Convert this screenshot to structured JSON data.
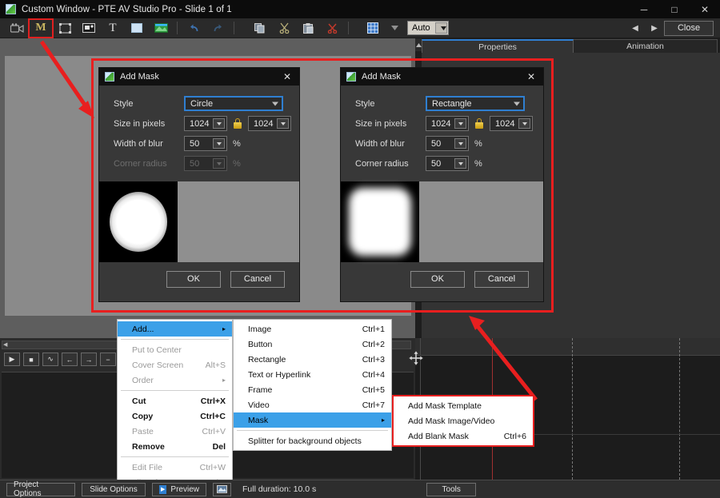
{
  "window": {
    "title": "Custom Window - PTE AV Studio Pro - Slide 1 of 1",
    "minimize": "─",
    "maximize": "□",
    "close": "✕"
  },
  "toolbar": {
    "items": [
      {
        "name": "camera-icon",
        "glyph": "🎥"
      },
      {
        "name": "mask-icon",
        "glyph": "M"
      },
      {
        "name": "frame-icon",
        "glyph": "⬜"
      },
      {
        "name": "image-icon",
        "glyph": "🖼"
      },
      {
        "name": "text-icon",
        "glyph": "T"
      },
      {
        "name": "rectangle-icon",
        "glyph": "■"
      },
      {
        "name": "video-icon",
        "glyph": "▰"
      },
      {
        "name": "undo-icon",
        "glyph": "↶"
      },
      {
        "name": "redo-icon",
        "glyph": "↷"
      },
      {
        "name": "copy-icon",
        "glyph": "⧉"
      },
      {
        "name": "cut-icon",
        "glyph": "✂"
      },
      {
        "name": "paste-icon",
        "glyph": "📋"
      },
      {
        "name": "delete-icon",
        "glyph": "✗"
      },
      {
        "name": "grid-icon",
        "glyph": "▦"
      }
    ],
    "zoom_value": "Auto",
    "prev_label": "◀",
    "next_label": "▶",
    "close_label": "Close"
  },
  "tabs": [
    {
      "label": "Properties",
      "active": true
    },
    {
      "label": "Animation",
      "active": false
    }
  ],
  "player_controls": [
    {
      "name": "play-button",
      "glyph": "▶"
    },
    {
      "name": "stop-button",
      "glyph": "■"
    },
    {
      "name": "waveform-button",
      "glyph": "∿"
    },
    {
      "name": "previous-button",
      "glyph": "←"
    },
    {
      "name": "next-button",
      "glyph": "→"
    },
    {
      "name": "zoom-out-button",
      "glyph": "−"
    },
    {
      "name": "zoom-in-button",
      "glyph": "+"
    }
  ],
  "dialog_left": {
    "title": "Add Mask",
    "close_glyph": "✕",
    "fields": {
      "style_label": "Style",
      "style_value": "Circle",
      "size_label": "Size in pixels",
      "size_width": "1024",
      "size_height": "1024",
      "blur_label": "Width of blur",
      "blur_value": "50",
      "blur_unit": "%",
      "corner_label": "Corner radius",
      "corner_value": "50",
      "corner_unit": "%"
    },
    "ok_label": "OK",
    "cancel_label": "Cancel"
  },
  "dialog_right": {
    "title": "Add Mask",
    "close_glyph": "✕",
    "fields": {
      "style_label": "Style",
      "style_value": "Rectangle",
      "size_label": "Size in pixels",
      "size_width": "1024",
      "size_height": "1024",
      "blur_label": "Width of blur",
      "blur_value": "50",
      "blur_unit": "%",
      "corner_label": "Corner radius",
      "corner_value": "50",
      "corner_unit": "%"
    },
    "ok_label": "OK",
    "cancel_label": "Cancel"
  },
  "context_menu": {
    "items": [
      {
        "label": "Add...",
        "accel": "",
        "submenu": true,
        "disabled": false,
        "selected": true,
        "bold": false
      },
      {
        "sep": true
      },
      {
        "label": "Put to Center",
        "accel": "",
        "submenu": false,
        "disabled": true
      },
      {
        "label": "Cover Screen",
        "accel": "Alt+S",
        "submenu": false,
        "disabled": true
      },
      {
        "label": "Order",
        "accel": "",
        "submenu": true,
        "disabled": true
      },
      {
        "sep": true
      },
      {
        "label": "Cut",
        "accel": "Ctrl+X",
        "submenu": false,
        "disabled": false,
        "bold": true
      },
      {
        "label": "Copy",
        "accel": "Ctrl+C",
        "submenu": false,
        "disabled": false,
        "bold": true
      },
      {
        "label": "Paste",
        "accel": "Ctrl+V",
        "submenu": false,
        "disabled": true
      },
      {
        "label": "Remove",
        "accel": "Del",
        "submenu": false,
        "disabled": false,
        "bold": true
      },
      {
        "sep": true
      },
      {
        "label": "Edit File",
        "accel": "Ctrl+W",
        "submenu": false,
        "disabled": true
      },
      {
        "label": "File Info",
        "accel": "Ctrl+I",
        "submenu": false,
        "disabled": true
      }
    ]
  },
  "add_submenu": {
    "items": [
      {
        "label": "Image",
        "accel": "Ctrl+1",
        "submenu": false,
        "selected": false
      },
      {
        "label": "Button",
        "accel": "Ctrl+2",
        "submenu": false,
        "selected": false
      },
      {
        "label": "Rectangle",
        "accel": "Ctrl+3",
        "submenu": false,
        "selected": false
      },
      {
        "label": "Text or Hyperlink",
        "accel": "Ctrl+4",
        "submenu": false,
        "selected": false
      },
      {
        "label": "Frame",
        "accel": "Ctrl+5",
        "submenu": false,
        "selected": false
      },
      {
        "label": "Video",
        "accel": "Ctrl+7",
        "submenu": false,
        "selected": false
      },
      {
        "label": "Mask",
        "accel": "",
        "submenu": true,
        "selected": true
      },
      {
        "sep": true
      },
      {
        "label": "Splitter for background objects",
        "accel": "",
        "submenu": false,
        "selected": false
      }
    ]
  },
  "mask_submenu": {
    "items": [
      {
        "label": "Add Mask Template",
        "accel": ""
      },
      {
        "label": "Add Mask Image/Video",
        "accel": ""
      },
      {
        "label": "Add Blank Mask",
        "accel": "Ctrl+6"
      }
    ]
  },
  "bottom_bar": {
    "project_options": "Project Options",
    "slide_options": "Slide Options",
    "preview": "Preview",
    "duration": "Full duration: 10.0 s",
    "tools": "Tools"
  },
  "colors": {
    "accent_blue": "#2f7fd1",
    "highlight_red": "#e81f1f",
    "menu_select_blue": "#3ba0e8",
    "lock_gold": "#d4a520"
  }
}
